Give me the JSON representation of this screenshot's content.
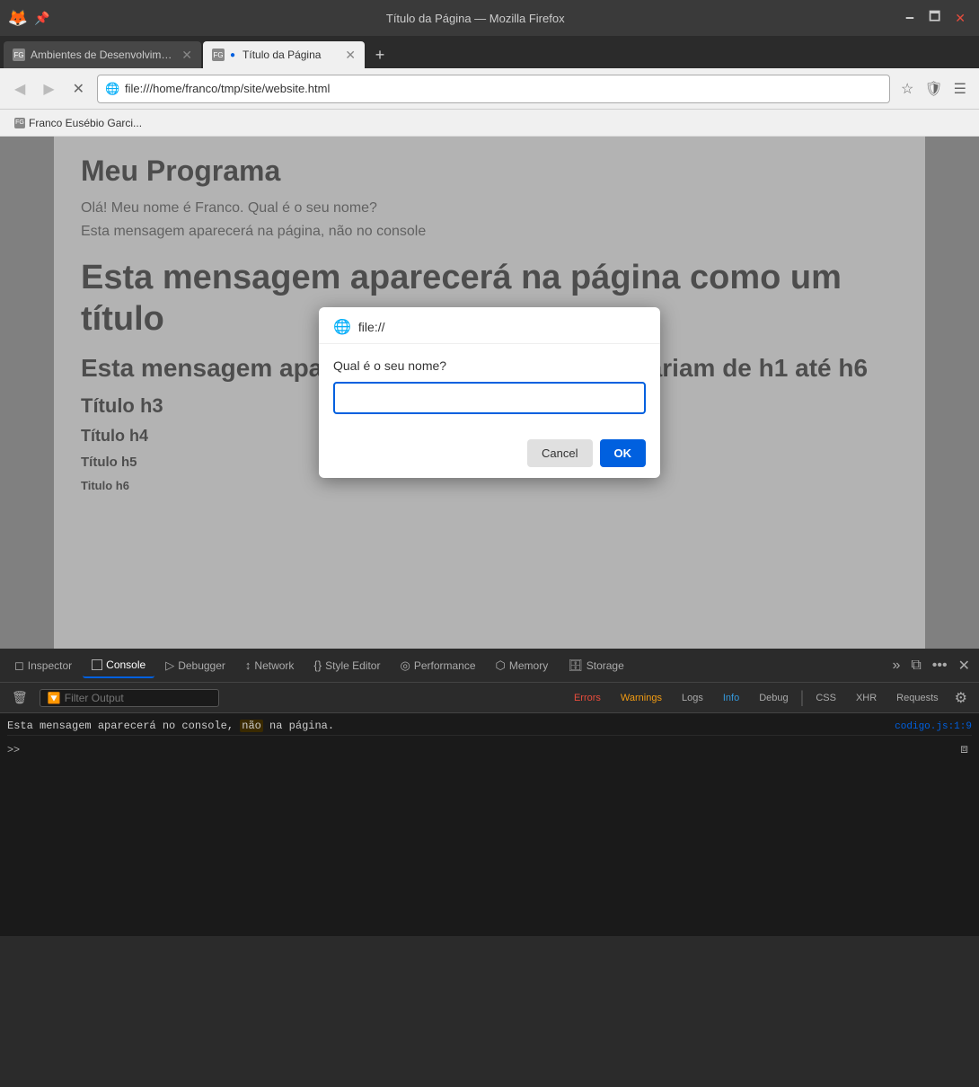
{
  "browser": {
    "title": "Título da Página — Mozilla Firefox",
    "tabs": [
      {
        "id": "tab1",
        "title": "Ambientes de Desenvolvimen...",
        "favicon": "FG",
        "active": false,
        "modified": false
      },
      {
        "id": "tab2",
        "title": "Título da Página",
        "favicon": "FG",
        "active": true,
        "modified": true
      }
    ],
    "nav": {
      "back_disabled": true,
      "forward_disabled": true,
      "url": "file:///home/franco/tmp/site/website.html",
      "url_icon": "🌐"
    },
    "bookmark": {
      "favicon": "FG",
      "label": "Franco Eusébio Garci..."
    }
  },
  "page": {
    "h1": "Meu Programa",
    "p1": "Olá! Meu nome é Franco. Qual é o seu nome?",
    "p2": "Esta mensagem aparecerá na página, não no console",
    "h1_large": "Esta mensagem aparecerá na página como um título",
    "h2": "Esta mensagem apa                          ulo h2; títulos variam de h1 até h6",
    "h3": "Título h3",
    "h4": "Título h4",
    "h5": "Título h5",
    "h6": "Titulo h6"
  },
  "dialog": {
    "header_icon": "🌐",
    "header_url": "file://",
    "label": "Qual é o seu nome?",
    "input_placeholder": "",
    "cancel_label": "Cancel",
    "ok_label": "OK"
  },
  "devtools": {
    "tabs": [
      {
        "id": "inspector",
        "label": "Inspector",
        "icon": "◻",
        "active": false
      },
      {
        "id": "console",
        "label": "Console",
        "icon": "⬛",
        "active": true
      },
      {
        "id": "debugger",
        "label": "Debugger",
        "icon": "◁",
        "active": false
      },
      {
        "id": "network",
        "label": "Network",
        "icon": "↕",
        "active": false
      },
      {
        "id": "style-editor",
        "label": "Style Editor",
        "icon": "{}",
        "active": false
      },
      {
        "id": "performance",
        "label": "Performance",
        "icon": "◎",
        "active": false
      },
      {
        "id": "memory",
        "label": "Memory",
        "icon": "🗄",
        "active": false
      },
      {
        "id": "storage",
        "label": "Storage",
        "icon": "🗄",
        "active": false
      }
    ],
    "toolbar_right": {
      "more_icon": "»",
      "new_window_icon": "⧉",
      "ellipsis_icon": "…",
      "close_icon": "✕"
    },
    "console": {
      "trash_icon": "🗑",
      "filter_placeholder": "Filter Output",
      "filter_buttons": [
        {
          "id": "errors",
          "label": "Errors",
          "type": "errors"
        },
        {
          "id": "warnings",
          "label": "Warnings",
          "type": "warnings"
        },
        {
          "id": "logs",
          "label": "Logs",
          "type": "logs"
        },
        {
          "id": "info",
          "label": "Info",
          "type": "info"
        },
        {
          "id": "debug",
          "label": "Debug",
          "type": "debug"
        },
        {
          "id": "css",
          "label": "CSS",
          "type": "css"
        },
        {
          "id": "xhr",
          "label": "XHR",
          "type": "xhr"
        },
        {
          "id": "requests",
          "label": "Requests",
          "type": "requests"
        }
      ],
      "log_lines": [
        {
          "text_before": "Esta mensagem aparecerá no console, ",
          "highlight": "não",
          "text_after": " na página.",
          "source": "codigo.js:1:9"
        }
      ],
      "prompt": "»"
    }
  }
}
